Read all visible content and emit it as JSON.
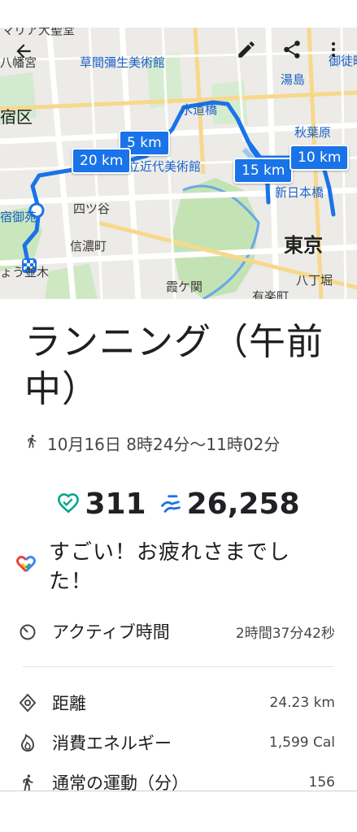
{
  "map": {
    "places": {
      "maria_stadium": "マリア大聖堂",
      "hachiman": "八幡宮",
      "shinjuku_ward": "宿区",
      "kusama_museum": "草間彌生美術館",
      "suidobashi": "水道橋",
      "yushima": "湯島",
      "okachimachi": "御徒町",
      "akihabara": "秋葉原",
      "kokuritsu": "国立近代美術館",
      "yotsuya": "四ツ谷",
      "shinjuku_gyoen": "宿御苑",
      "shinanomachi": "信濃町",
      "shin_nihonbashi": "新日本橋",
      "tokyo": "東京",
      "namiki": "ょう並木",
      "kasumigaseki": "霞ケ関",
      "hatchobori": "八丁堀",
      "yurakucho": "有楽町"
    },
    "km_badges": [
      "5 km",
      "20 km",
      "15 km",
      "10 km"
    ]
  },
  "activity": {
    "title": "ランニング（午前中）",
    "time_range": "10月16日 8時24分〜11時02分",
    "heart_points": "311",
    "steps": "26,258",
    "praise": "すごい！お疲れさまでした！"
  },
  "details": [
    {
      "label": "アクティブ時間",
      "value": "2時間37分42秒"
    },
    {
      "label": "距離",
      "value": "24.23 km"
    },
    {
      "label": "消費エネルギー",
      "value": "1,599 Cal"
    },
    {
      "label": "通常の運動（分）",
      "value": "156"
    }
  ],
  "colors": {
    "route": "#1a73e8",
    "heart": "#00a38d",
    "steps": "#1a73e8",
    "park": "#c4e3b5"
  }
}
